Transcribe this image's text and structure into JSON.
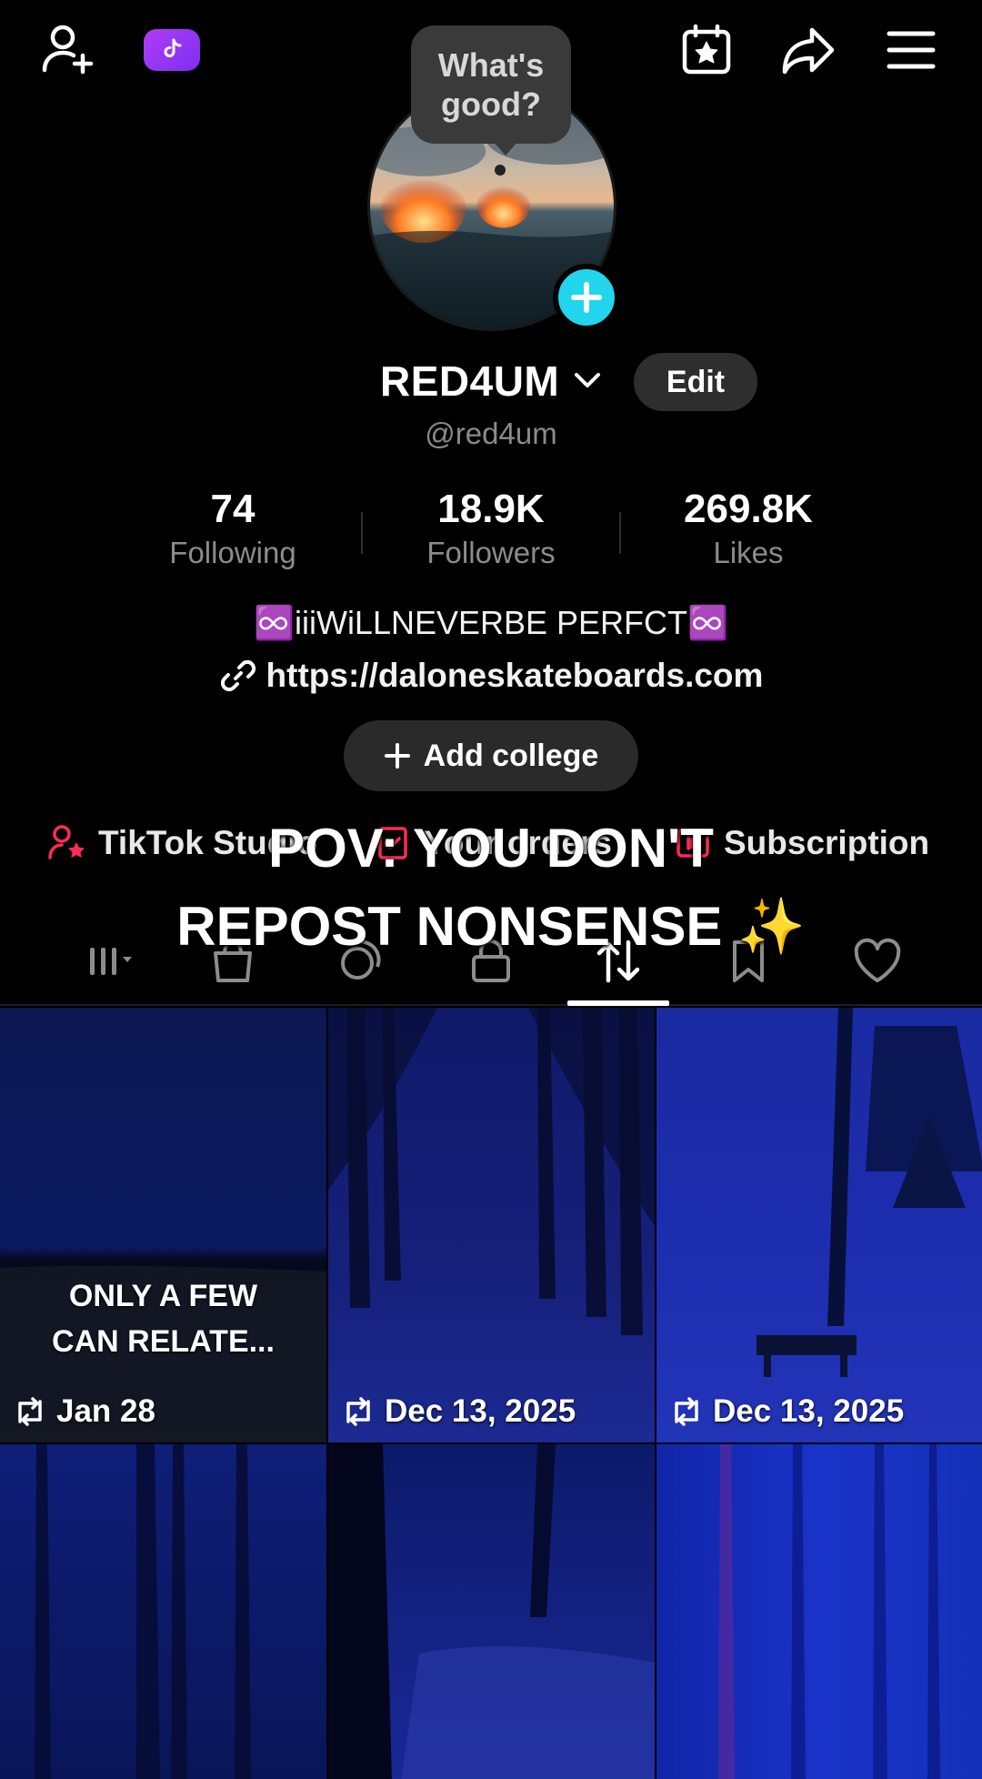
{
  "topbar": {
    "icons": [
      "add-friend-icon",
      "tiktok-studio-badge-icon",
      "calendar-star-icon",
      "share-icon",
      "menu-icon"
    ],
    "accent_badge": "#9b3bf5"
  },
  "bubble": {
    "text": "What's good?"
  },
  "profile": {
    "display_name": "RED4UM",
    "edit_label": "Edit",
    "username": "@red4um",
    "add_avatar_color": "#20d5ec"
  },
  "stats": [
    {
      "value": "74",
      "label": "Following"
    },
    {
      "value": "18.9K",
      "label": "Followers"
    },
    {
      "value": "269.8K",
      "label": "Likes"
    }
  ],
  "bio": {
    "text": "♾️iiiWiLLNEVERBE PERFCT♾️",
    "link": "https://daloneskateboards.com"
  },
  "college_button": {
    "label": "Add college"
  },
  "shortcuts": [
    {
      "label": "TikTok Studio",
      "icon": "studio-person-star-icon"
    },
    {
      "label": "Your orders",
      "icon": "orders-icon"
    },
    {
      "label": "Subscription",
      "icon": "subscription-icon"
    }
  ],
  "overlay_caption": {
    "line1": "POV: YOU DON'T",
    "line2": "REPOST NONSENSE ✨"
  },
  "tabs": [
    {
      "name": "videos",
      "icon": "grid-filter-icon"
    },
    {
      "name": "shop",
      "icon": "shopping-bag-icon"
    },
    {
      "name": "stories",
      "icon": "stories-icon"
    },
    {
      "name": "private",
      "icon": "lock-icon"
    },
    {
      "name": "reposts",
      "icon": "repost-icon",
      "active": true
    },
    {
      "name": "saved",
      "icon": "bookmark-icon"
    },
    {
      "name": "liked",
      "icon": "heart-icon"
    }
  ],
  "grid": {
    "items": [
      {
        "caption_line1": "ONLY A FEW",
        "caption_line2": "CAN RELATE...",
        "date": "Jan 28"
      },
      {
        "caption_line1": "",
        "caption_line2": "",
        "date": "Dec 13, 2025"
      },
      {
        "caption_line1": "",
        "caption_line2": "",
        "date": "Dec 13, 2025"
      },
      {
        "caption_line1": "",
        "caption_line2": "",
        "date": ""
      },
      {
        "caption_line1": "",
        "caption_line2": "",
        "date": ""
      },
      {
        "caption_line1": "",
        "caption_line2": "",
        "date": ""
      }
    ]
  }
}
